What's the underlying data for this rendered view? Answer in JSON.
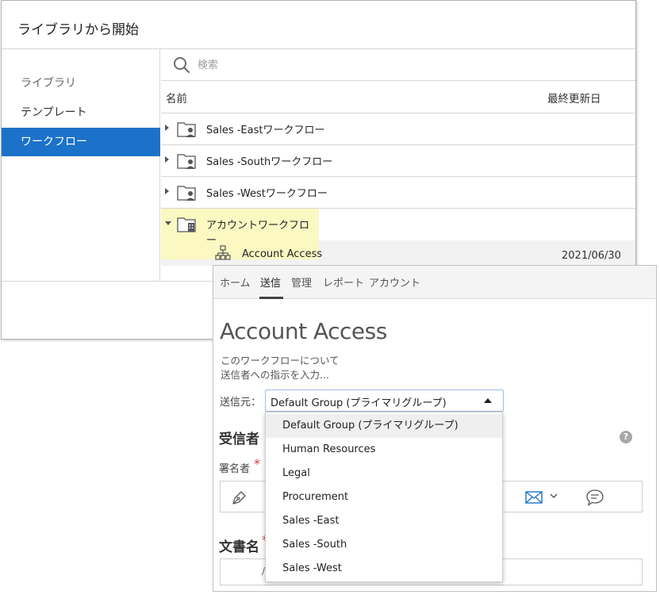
{
  "dialog": {
    "title": "ライブラリから開始",
    "nav": [
      {
        "label": "ライブラリ"
      },
      {
        "label": "テンプレート"
      },
      {
        "label": "ワークフロー"
      }
    ],
    "search": {
      "placeholder": "検索"
    },
    "columns": {
      "name": "名前",
      "updated": "最終更新日"
    },
    "rows": [
      {
        "label": "Sales -Eastワークフロー",
        "expanded": false
      },
      {
        "label": "Sales -Southワークフロー",
        "expanded": false
      },
      {
        "label": "Sales -Westワークフロー",
        "expanded": false
      },
      {
        "label": "アカウントワークフロー",
        "expanded": true
      }
    ],
    "sub_row": {
      "label": "Account Access",
      "date": "2021/06/30"
    }
  },
  "send": {
    "tabs": [
      "ホーム",
      "送信",
      "管理",
      "レポート",
      "アカウント"
    ],
    "active_tab": "送信",
    "title": "Account Access",
    "about_line1": "このワークフローについて",
    "about_line2": "送信者への指示を入力...",
    "from_label": "送信元：",
    "from_value": "Default Group (プライマリグループ)",
    "recipients_heading": "受信者",
    "help_symbol": "?",
    "signer_label": "署名者",
    "required_mark": "*",
    "docname_heading": "文書名",
    "doc_fragment": "/"
  },
  "dropdown": {
    "options": [
      "Default Group (プライマリグループ)",
      "Human Resources",
      "Legal",
      "Procurement",
      "Sales -East",
      "Sales -South",
      "Sales -West"
    ],
    "selected_index": 0
  },
  "colors": {
    "accent": "#1c72c9",
    "highlight": "#fbf8c2",
    "required": "#d7373f"
  },
  "icons": [
    "search-icon",
    "shared-folder-icon",
    "workflow-icon",
    "pen-icon",
    "mail-icon",
    "chevron-down-icon",
    "comment-icon",
    "help-icon"
  ]
}
